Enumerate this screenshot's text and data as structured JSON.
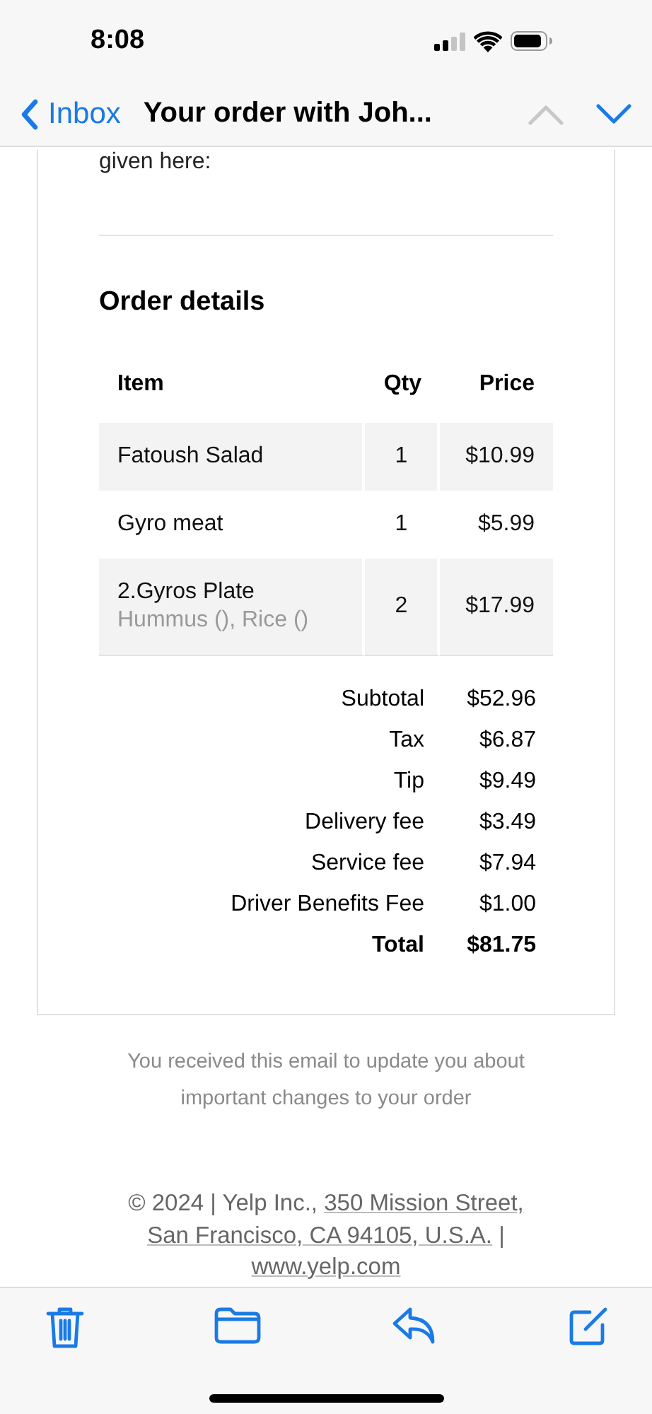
{
  "status_bar": {
    "time": "8:08"
  },
  "nav": {
    "back_label": "Inbox",
    "title": "Your order with Joh...",
    "previous_disabled": true,
    "next_disabled": false
  },
  "email": {
    "intro_tail": "given here:",
    "heading": "Order details",
    "columns": [
      "Item",
      "Qty",
      "Price"
    ],
    "items": [
      {
        "name": "Fatoush Salad",
        "qty": "1",
        "price": "$10.99",
        "shaded": true
      },
      {
        "name": "Gyro meat",
        "qty": "1",
        "price": "$5.99",
        "shaded": false
      },
      {
        "name": "2.Gyros Plate",
        "options": "Hummus (), Rice ()",
        "qty": "2",
        "price": "$17.99",
        "shaded": true
      }
    ],
    "totals": [
      {
        "label": "Subtotal",
        "value": "$52.96",
        "bold": false
      },
      {
        "label": "Tax",
        "value": "$6.87",
        "bold": false
      },
      {
        "label": "Tip",
        "value": "$9.49",
        "bold": false
      },
      {
        "label": "Delivery fee",
        "value": "$3.49",
        "bold": false
      },
      {
        "label": "Service fee",
        "value": "$7.94",
        "bold": false
      },
      {
        "label": "Driver Benefits Fee",
        "value": "$1.00",
        "bold": false
      },
      {
        "label": "Total",
        "value": "$81.75",
        "bold": true
      }
    ],
    "notice": "You received this email to update you about important changes to your order",
    "footer": {
      "prefix": "© 2024 | Yelp Inc.,",
      "address_line_1": "350 Mission Street,",
      "address_line_2": "San Francisco, CA 94105, U.S.A.",
      "separator": "|",
      "website": "www.yelp.com"
    }
  }
}
